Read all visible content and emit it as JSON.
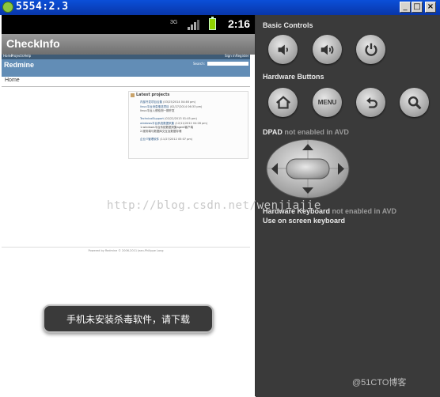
{
  "window": {
    "title": "5554:2.3",
    "minimize_label": "_",
    "maximize_label": "□",
    "close_label": "×"
  },
  "status_bar": {
    "network": "3G",
    "time": "2:16"
  },
  "app": {
    "title": "CheckInfo"
  },
  "web": {
    "top_menu": [
      "Home",
      "Projects",
      "Help"
    ],
    "account_menu": [
      "Sign in",
      "Register"
    ],
    "site_title": "Redmine",
    "search_label": "Search:",
    "tab_home": "Home",
    "latest_projects_title": "Latest projects",
    "projects": [
      {
        "name": "内部开发项目合集",
        "date": "(03/25/2014 04:46 pm)"
      },
      {
        "name": "linux平台消息推送项目",
        "date": "(02/27/2014 06:33 pm)"
      },
      {
        "name": "TechnicalSupport",
        "date": "(02/22/2013 01:45 pm)"
      },
      {
        "name": "windows平台系统数据采集",
        "date": "(12/11/2012 04:28 pm)"
      },
      {
        "name": "企业IT管理软件",
        "date": "(11/27/2012 05:07 pm)"
      }
    ],
    "project_descriptions": [
      "linux平台入侵检测一期开发",
      "1.windows平台系统数据采集agent客户端",
      "2.服务端与数据库交互及数据存储"
    ],
    "footer": "Powered by Redmine © 2006-2011 Jean-Philippe Lang"
  },
  "toast": {
    "message": "手机未安装杀毒软件，请下载"
  },
  "watermark": "http://blog.csdn.net/wenjiajie",
  "panel": {
    "basic_controls_label": "Basic Controls",
    "hardware_buttons_label": "Hardware Buttons",
    "menu_label": "MENU",
    "dpad_label": "DPAD",
    "dpad_status": "not enabled in AVD",
    "keyboard_label": "Hardware Keyboard",
    "keyboard_status": "not enabled in AVD",
    "onscreen_keyboard_label": "Use on screen keyboard",
    "icons": {
      "volume_down": "volume-down-icon",
      "volume_up": "volume-up-icon",
      "power": "power-icon",
      "home": "home-icon",
      "back": "back-icon",
      "search": "search-icon"
    }
  },
  "corner_watermark": "@51CTO博客",
  "colors": {
    "title_bar": "#0b4fd8",
    "panel_bg": "#3a3a3a",
    "redmine_header": "#628db6",
    "toast_bg": "#3a3a3a"
  }
}
